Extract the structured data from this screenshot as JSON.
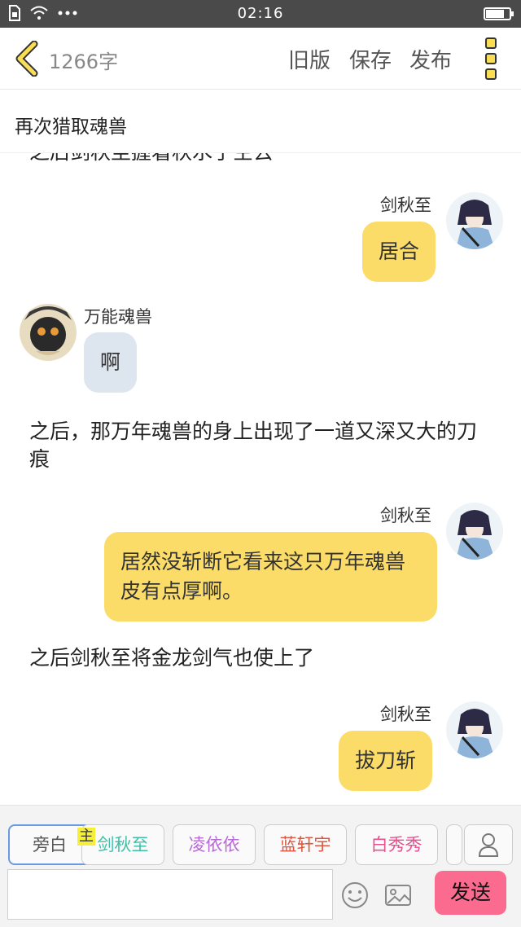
{
  "status_bar": {
    "time": "02:16",
    "battery_level": 0.8
  },
  "header": {
    "word_count": "1266字",
    "old_version": "旧版",
    "save": "保存",
    "publish": "发布"
  },
  "title": "再次猎取魂兽",
  "chat": {
    "partial_text": "之后剑秋至握着秋水于空去",
    "messages": [
      {
        "speaker": "剑秋至",
        "text": "居合"
      },
      {
        "speaker": "万能魂兽",
        "text": "啊"
      },
      {
        "narration": "之后，那万年魂兽的身上出现了一道又深又大的刀痕"
      },
      {
        "speaker": "剑秋至",
        "text": "居然没斩断它看来这只万年魂兽皮有点厚啊。"
      },
      {
        "narration": "之后剑秋至将金龙剑气也使上了"
      },
      {
        "speaker": "剑秋至",
        "text": "拔刀斩"
      }
    ]
  },
  "characters": [
    {
      "name": "旁白",
      "color": "#888888"
    },
    {
      "name": "剑秋至",
      "color": "#3fbfa6"
    },
    {
      "name": "凌依依",
      "color": "#b86ad8"
    },
    {
      "name": "蓝轩宇",
      "color": "#e0553f"
    },
    {
      "name": "白秀秀",
      "color": "#e8508f"
    }
  ],
  "host_tag": "主",
  "send_label": "发送",
  "colors": {
    "accent_yellow": "#fbdc68",
    "send_pink": "#fb6a8f",
    "npc_bubble": "#dde5ee"
  }
}
